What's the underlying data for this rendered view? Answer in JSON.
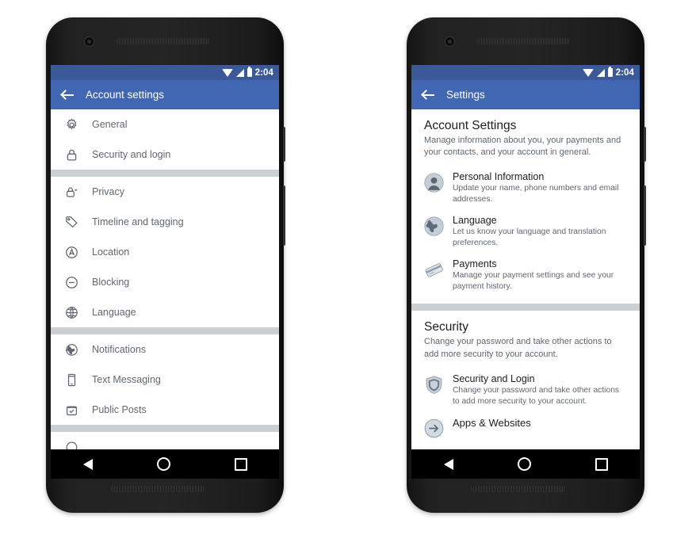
{
  "page": {
    "background_color": "#ffffff"
  },
  "colors": {
    "statusbar_blue": "#3b5998",
    "appbar_blue": "#4267b2",
    "divider_gray": "#ccd0d5",
    "text_primary": "#1c1e21",
    "text_secondary": "#606770"
  },
  "status_bar": {
    "time": "2:04",
    "icons": [
      "wifi-icon",
      "signal-icon",
      "battery-icon"
    ]
  },
  "phones": [
    {
      "name": "left-phone",
      "appbar": {
        "back_icon": "back-arrow-icon",
        "title": "Account settings"
      },
      "groups": [
        {
          "rows": [
            {
              "icon": "gear-icon",
              "label": "General"
            },
            {
              "icon": "lock-icon",
              "label": "Security and login"
            }
          ]
        },
        {
          "rows": [
            {
              "icon": "privacy-lock-icon",
              "label": "Privacy"
            },
            {
              "icon": "tag-icon",
              "label": "Timeline and tagging"
            },
            {
              "icon": "location-pin-icon",
              "label": "Location"
            },
            {
              "icon": "block-icon",
              "label": "Blocking"
            },
            {
              "icon": "globe-outline-icon",
              "label": "Language"
            }
          ]
        },
        {
          "rows": [
            {
              "icon": "globe-filled-icon",
              "label": "Notifications"
            },
            {
              "icon": "phone-icon",
              "label": "Text Messaging"
            },
            {
              "icon": "check-badge-icon",
              "label": "Public Posts"
            }
          ]
        }
      ],
      "nav": {
        "back": "nav-back-icon",
        "home": "nav-home-icon",
        "recents": "nav-recents-icon"
      }
    },
    {
      "name": "right-phone",
      "appbar": {
        "back_icon": "back-arrow-icon",
        "title": "Settings"
      },
      "sections": [
        {
          "title": "Account Settings",
          "description": "Manage information about you, your payments and your contacts, and your account in general.",
          "items": [
            {
              "icon": "person-circle-icon",
              "title": "Personal Information",
              "description": "Update your name, phone numbers and email addresses."
            },
            {
              "icon": "globe-circle-icon",
              "title": "Language",
              "description": "Let us know your language and translation preferences."
            },
            {
              "icon": "credit-card-icon",
              "title": "Payments",
              "description": "Manage your payment settings and see your payment history."
            }
          ]
        },
        {
          "title": "Security",
          "description": "Change your password and take other actions to add more security to your account.",
          "items": [
            {
              "icon": "shield-icon",
              "title": "Security and Login",
              "description": "Change your password and take other actions to add more security to your account."
            },
            {
              "icon": "apps-arrow-icon",
              "title": "Apps & Websites",
              "description": ""
            }
          ]
        }
      ],
      "nav": {
        "back": "nav-back-icon",
        "home": "nav-home-icon",
        "recents": "nav-recents-icon"
      }
    }
  ]
}
